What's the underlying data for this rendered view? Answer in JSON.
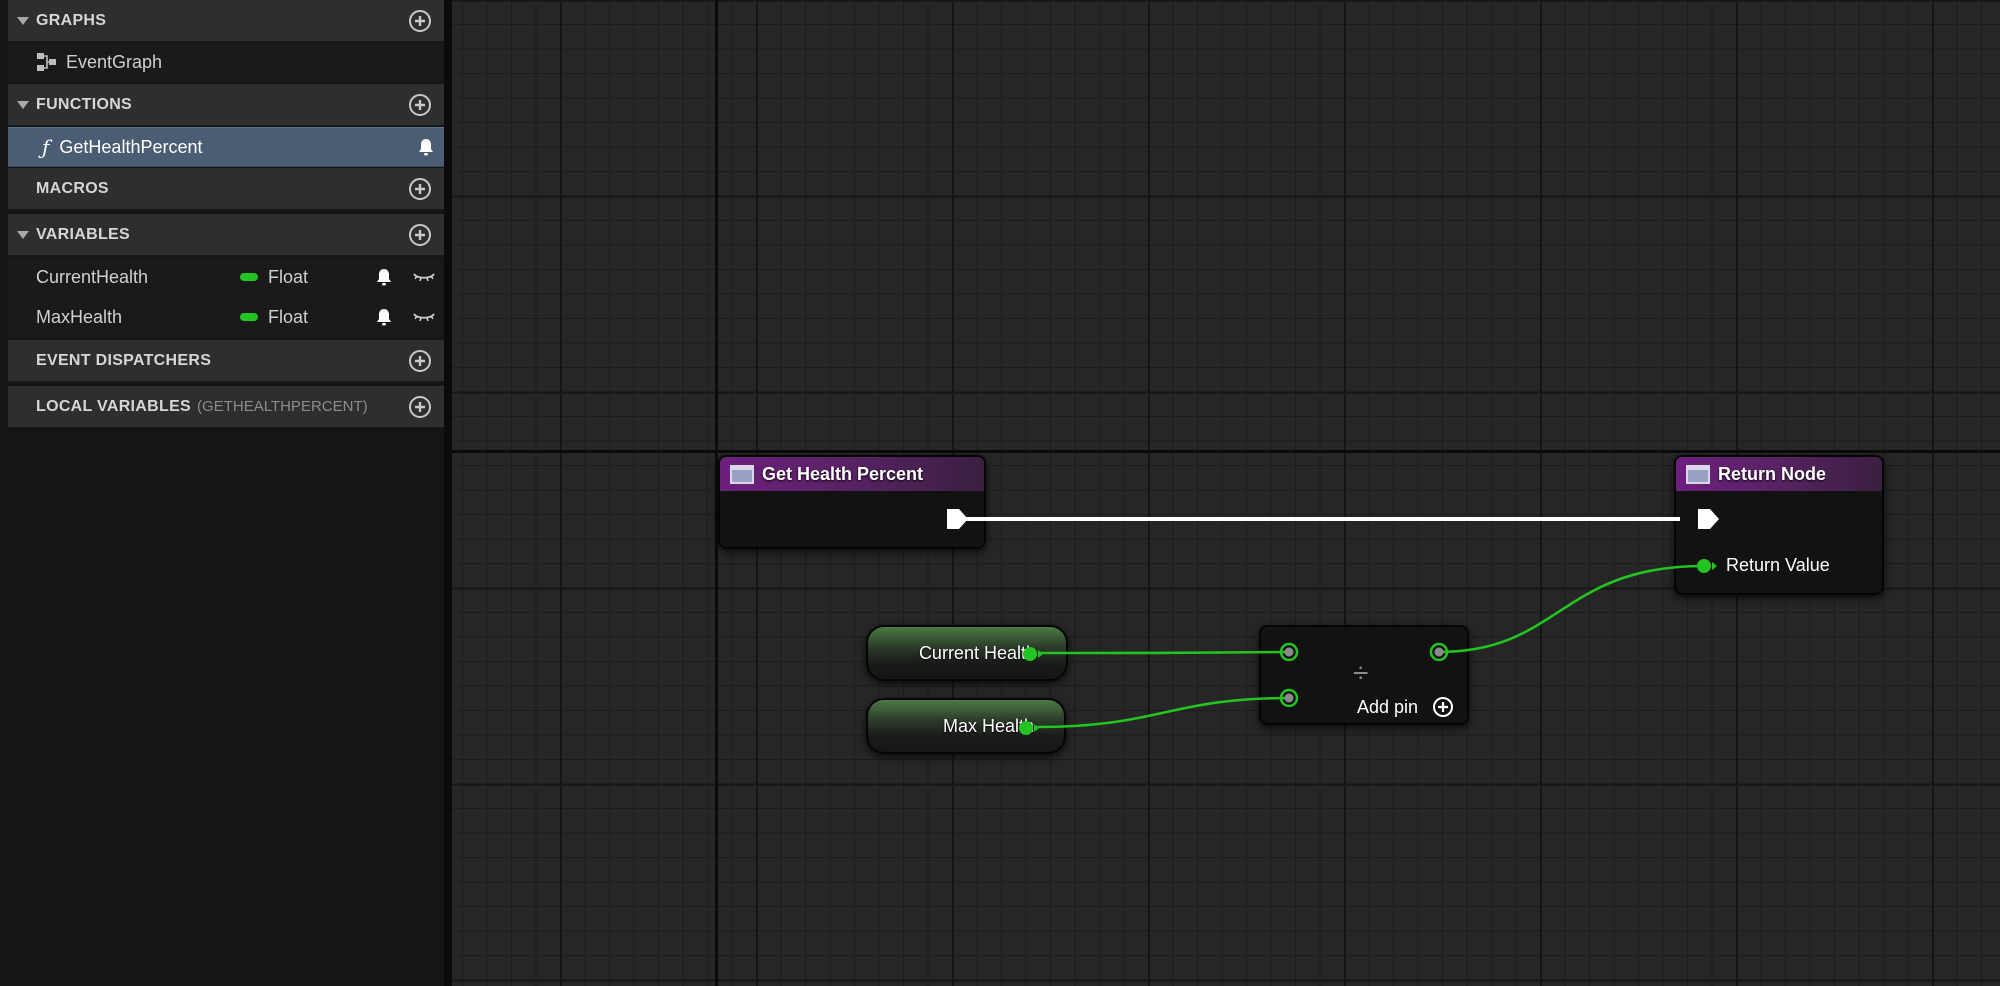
{
  "panel": {
    "sections": {
      "graphs": "GRAPHS",
      "functions": "FUNCTIONS",
      "macros": "MACROS",
      "variables": "VARIABLES",
      "event_dispatchers": "EVENT DISPATCHERS",
      "local_variables": "LOCAL VARIABLES",
      "local_variables_scope": "(GETHEALTHPERCENT)"
    },
    "graph_items": [
      "EventGraph"
    ],
    "function_items": [
      "GetHealthPercent"
    ],
    "variables": [
      {
        "name": "CurrentHealth",
        "type": "Float"
      },
      {
        "name": "MaxHealth",
        "type": "Float"
      }
    ]
  },
  "graph": {
    "entry_node_title": "Get Health Percent",
    "return_node_title": "Return Node",
    "return_value_label": "Return Value",
    "var_nodes": [
      "Current Health",
      "Max Health"
    ],
    "divide_symbol": "÷",
    "add_pin_label": "Add pin"
  },
  "colors": {
    "float_pin": "#23c322",
    "exec_wire": "#ffffff",
    "function_header": "#6d1f7e",
    "selection": "#4a5d72"
  }
}
